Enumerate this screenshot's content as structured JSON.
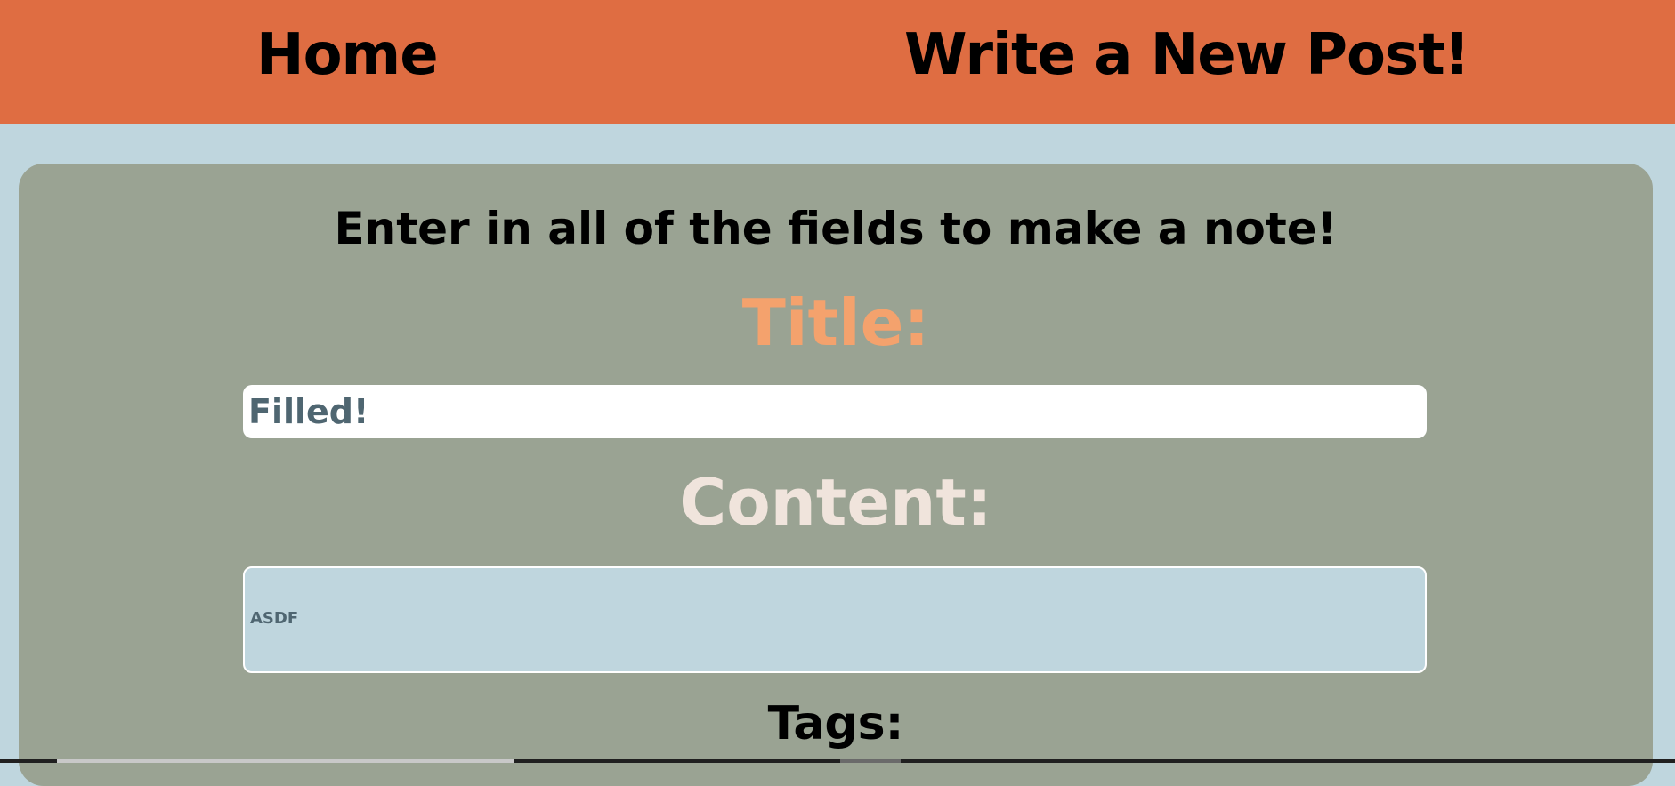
{
  "nav": {
    "home_label": "Home",
    "new_post_label": "Write a New Post!"
  },
  "form": {
    "intro": "Enter in all of the fields to make a note!",
    "title_label": "Title:",
    "title_value": "Filled!",
    "content_label": "Content:",
    "content_value": "ASDF",
    "tags_label": "Tags:"
  },
  "colors": {
    "navbar": "#df6d42",
    "page_background": "#bfd6de",
    "card": "#9aa393",
    "title_label": "#f4a26d",
    "content_label": "#f0e4dc",
    "input_text": "#4f6671"
  }
}
